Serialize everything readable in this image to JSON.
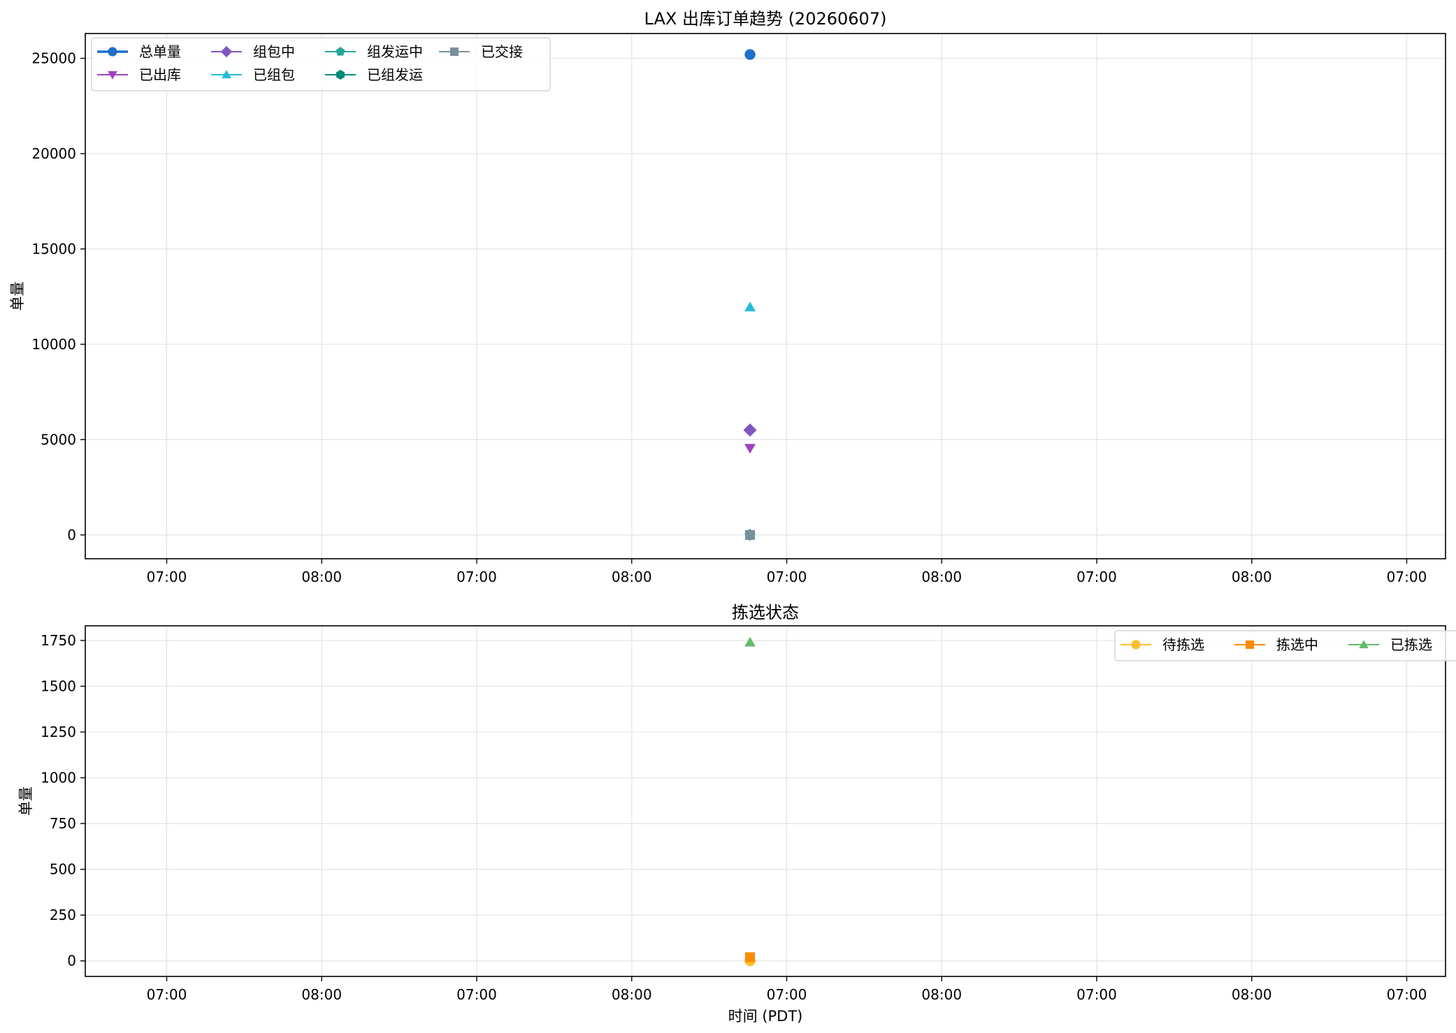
{
  "chart_data": [
    {
      "type": "line",
      "title": "LAX 出库订单趋势 (20260607)",
      "xlabel": "",
      "ylabel": "单量",
      "ylim": [
        -1250,
        26300
      ],
      "yticks": [
        0,
        5000,
        10000,
        15000,
        20000,
        25000
      ],
      "xticks": [
        "07:00",
        "08:00",
        "07:00",
        "08:00",
        "07:00",
        "08:00",
        "07:00",
        "08:00",
        "07:00"
      ],
      "grid": true,
      "legend_position": "top-left",
      "legend_columns": 4,
      "series": [
        {
          "name": "总单量",
          "color": "#1f6fc9",
          "marker": "circle",
          "values": [
            25200
          ]
        },
        {
          "name": "已出库",
          "color": "#a040c0",
          "marker": "triangle-down",
          "values": [
            4550
          ]
        },
        {
          "name": "组包中",
          "color": "#7e57c2",
          "marker": "diamond",
          "values": [
            5500
          ]
        },
        {
          "name": "已组包",
          "color": "#26bcd7",
          "marker": "triangle-up",
          "values": [
            11950
          ]
        },
        {
          "name": "组发运中",
          "color": "#26a69a",
          "marker": "pentagon",
          "values": [
            0
          ]
        },
        {
          "name": "已组发运",
          "color": "#00897b",
          "marker": "hexagon",
          "values": [
            0
          ]
        },
        {
          "name": "已交接",
          "color": "#78909c",
          "marker": "square",
          "values": [
            0
          ]
        }
      ],
      "x_position_fraction": 0.4887
    },
    {
      "type": "line",
      "title": "拣选状态",
      "xlabel": "时间 (PDT)",
      "ylabel": "单量",
      "ylim": [
        -85,
        1830
      ],
      "yticks": [
        0,
        250,
        500,
        750,
        1000,
        1250,
        1500,
        1750
      ],
      "xticks": [
        "07:00",
        "08:00",
        "07:00",
        "08:00",
        "07:00",
        "08:00",
        "07:00",
        "08:00",
        "07:00"
      ],
      "grid": true,
      "legend_position": "top-right",
      "legend_columns": 3,
      "series": [
        {
          "name": "待拣选",
          "color": "#fbc02d",
          "marker": "circle",
          "values": [
            0
          ]
        },
        {
          "name": "拣选中",
          "color": "#fb8c00",
          "marker": "square",
          "values": [
            20
          ]
        },
        {
          "name": "已拣选",
          "color": "#66bb6a",
          "marker": "triangle-up",
          "values": [
            1740
          ]
        }
      ],
      "x_position_fraction": 0.4887
    }
  ]
}
